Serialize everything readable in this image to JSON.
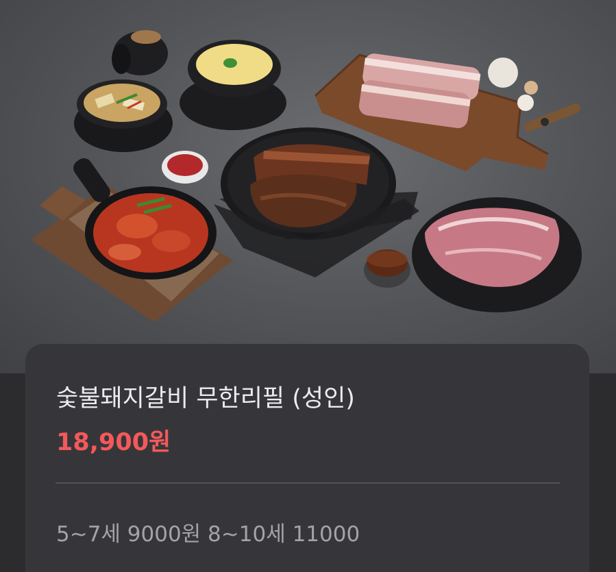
{
  "product": {
    "title": "숯불돼지갈비 무한리필 (성인)",
    "price": "18,900원",
    "description": "5~7세 9000원 8~10세 11000"
  },
  "colors": {
    "price_accent": "#f4595a",
    "card_background": "#36363a",
    "page_background": "#2c2c2e"
  }
}
